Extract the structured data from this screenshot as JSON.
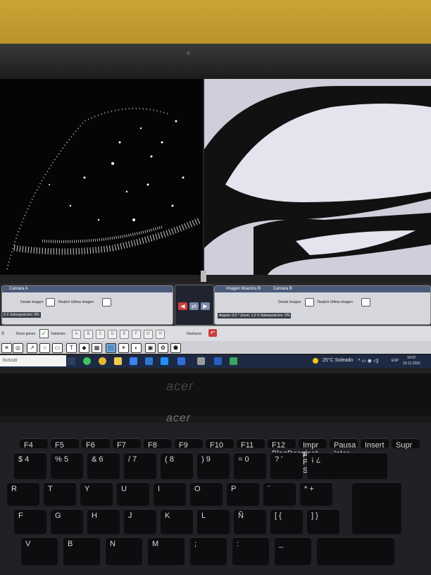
{
  "left_panel": {
    "title": "Camara A",
    "load_label": "Desde imagen",
    "reopen_label": "Reabrir Ultima Imagen",
    "overlap_label": "0 X Sobreposicion: 0%"
  },
  "right_panel": {
    "tab_sample": "Imagen Muestra B",
    "tab_camera": "Camara B",
    "load_label": "Desde Imagen",
    "reopen_label": "Reabrir Ultima Imagen",
    "status_line": "Angulo: 0.0 ° Zoom: 1.0 X Sobreposicion: 0%"
  },
  "toolbar": {
    "tonos_label": "Tonos grises",
    "variantes_label": "Variantes",
    "letters": [
      "A",
      "B",
      "C",
      "D",
      "E",
      "F",
      "G",
      "H"
    ],
    "undo_label": "Deshacer"
  },
  "taskbar": {
    "search_placeholder": "buscar",
    "weather": "25°C Soleado",
    "lang": "ESP",
    "time": "19:07",
    "date": "23-11-2021"
  },
  "laptop": {
    "brand": "acer",
    "brand_plate": "acer"
  },
  "keyboard": {
    "fn_row": [
      "F4",
      "F5",
      "F6",
      "F7",
      "F8",
      "F9",
      "F10",
      "F11",
      "F12 BloqDespl",
      "Impr pant Pet Sis",
      "Pausa Inter",
      "Insert",
      "Supr"
    ],
    "num_row": [
      "$ 4",
      "% 5",
      "& 6",
      "/ 7",
      "( 8",
      ") 9",
      "= 0",
      "? '",
      "¡ ¿"
    ],
    "row2": [
      "R",
      "T",
      "Y",
      "U",
      "I",
      "O",
      "P",
      "¨",
      "*  +"
    ],
    "row3": [
      "F",
      "G",
      "H",
      "J",
      "K",
      "L",
      "Ñ",
      "[ {",
      "] }"
    ],
    "row4": [
      "V",
      "B",
      "N",
      "M",
      ";",
      ":",
      "_"
    ]
  },
  "colors": {
    "panel_bg": "#d6d7dc",
    "undo_red": "#d23b3b",
    "taskbar": "#1d2a44",
    "wall": "#c9a435"
  }
}
